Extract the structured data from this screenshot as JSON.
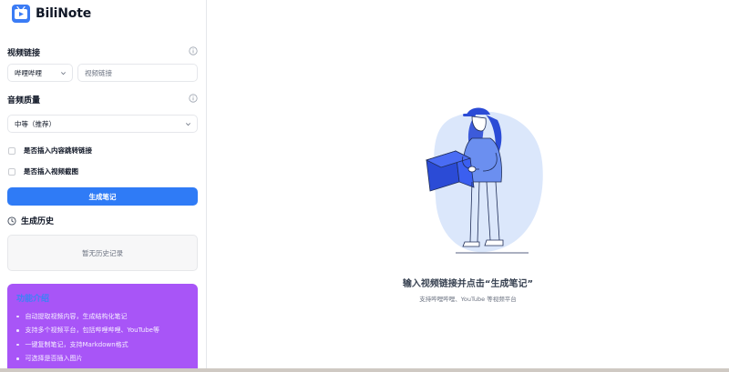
{
  "brand": {
    "name": "BiliNote"
  },
  "sidebar": {
    "video_link": {
      "title": "视频链接",
      "platform_value": "哔哩哔哩",
      "input_placeholder": "视频链接"
    },
    "audio_quality": {
      "title": "音频质量",
      "value": "中等（推荐）"
    },
    "options": [
      {
        "label": "是否插入内容跳转链接"
      },
      {
        "label": "是否插入视频截图"
      }
    ],
    "generate_button": "生成笔记",
    "history": {
      "title": "生成历史",
      "empty_text": "暂无历史记录"
    },
    "features": {
      "title": "功能介绍",
      "items": [
        "自动提取视频内容，生成结构化笔记",
        "支持多个视频平台，包括哔哩哔哩、YouTube等",
        "一键复制笔记，支持Markdown格式",
        "可选择是否插入图片"
      ]
    }
  },
  "main": {
    "empty_title": "输入视频链接并点击“生成笔记”",
    "empty_subtitle": "支持哔哩哔哩、YouTube 等视频平台"
  },
  "colors": {
    "primary": "#2f7bf6",
    "feature_card": "#a855f7",
    "illustration_blue": "#2b4bd6"
  },
  "icons": [
    "logo-icon",
    "info-icon",
    "chevron-down-icon",
    "clock-icon"
  ]
}
